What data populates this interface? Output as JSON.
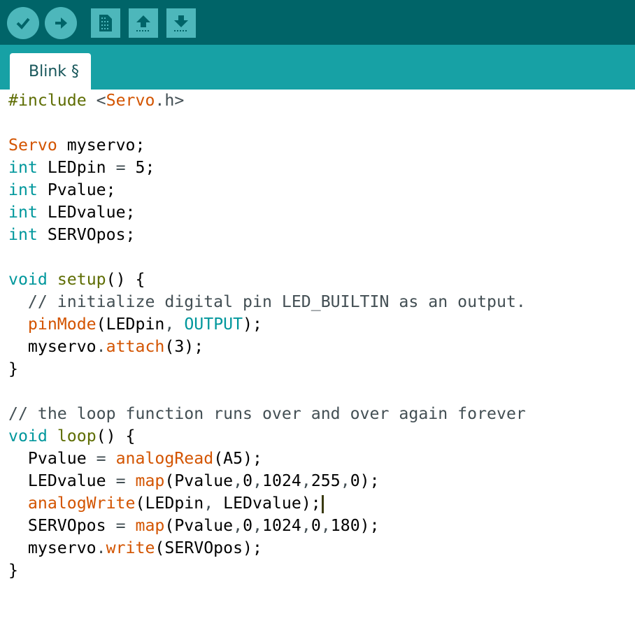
{
  "toolbar": {
    "buttons": [
      {
        "name": "verify-button",
        "icon": "check-icon"
      },
      {
        "name": "upload-button",
        "icon": "arrow-right-icon"
      },
      {
        "name": "new-button",
        "icon": "document-icon"
      },
      {
        "name": "open-button",
        "icon": "arrow-up-icon"
      },
      {
        "name": "save-button",
        "icon": "arrow-down-icon"
      }
    ]
  },
  "tab": {
    "label": "Blink §"
  },
  "colors": {
    "keyword": "#00979C",
    "function": "#D35400",
    "preprocessor": "#5E6D03",
    "toolbar": "#006468",
    "tabbar": "#17A1A5"
  },
  "code": [
    [
      [
        "#include ",
        "pp"
      ],
      [
        "<",
        "op"
      ],
      [
        "Servo",
        "fn"
      ],
      [
        ".h>",
        "op"
      ]
    ],
    [],
    [
      [
        "Servo",
        "fn"
      ],
      [
        " myservo;",
        ""
      ]
    ],
    [
      [
        "int",
        "kw"
      ],
      [
        " LEDpin ",
        ""
      ],
      [
        "=",
        "op"
      ],
      [
        " 5;",
        ""
      ]
    ],
    [
      [
        "int",
        "kw"
      ],
      [
        " Pvalue;",
        ""
      ]
    ],
    [
      [
        "int",
        "kw"
      ],
      [
        " LEDvalue;",
        ""
      ]
    ],
    [
      [
        "int",
        "kw"
      ],
      [
        " SERVOpos;",
        ""
      ]
    ],
    [],
    [
      [
        "void",
        "kw"
      ],
      [
        " ",
        ""
      ],
      [
        "setup",
        "pp"
      ],
      [
        "() {",
        ""
      ]
    ],
    [
      [
        "  // initialize digital pin LED_BUILTIN as an output.",
        "cm"
      ]
    ],
    [
      [
        "  ",
        ""
      ],
      [
        "pinMode",
        "fn"
      ],
      [
        "(LEDpin",
        ""
      ],
      [
        ", ",
        "op"
      ],
      [
        "OUTPUT",
        "kw"
      ],
      [
        ");",
        ""
      ]
    ],
    [
      [
        "  myservo",
        ""
      ],
      [
        ".",
        "op"
      ],
      [
        "attach",
        "fn"
      ],
      [
        "(3);",
        ""
      ]
    ],
    [
      [
        "}",
        ""
      ]
    ],
    [],
    [
      [
        "// the loop function runs over and over again forever",
        "cm"
      ]
    ],
    [
      [
        "void",
        "kw"
      ],
      [
        " ",
        ""
      ],
      [
        "loop",
        "pp"
      ],
      [
        "() {",
        ""
      ]
    ],
    [
      [
        "  Pvalue ",
        ""
      ],
      [
        "=",
        "op"
      ],
      [
        " ",
        ""
      ],
      [
        "analogRead",
        "fn"
      ],
      [
        "(A5);",
        ""
      ]
    ],
    [
      [
        "  LEDvalue ",
        ""
      ],
      [
        "=",
        "op"
      ],
      [
        " ",
        ""
      ],
      [
        "map",
        "fn"
      ],
      [
        "(Pvalue",
        ""
      ],
      [
        ",",
        "op"
      ],
      [
        "0",
        ""
      ],
      [
        ",",
        "op"
      ],
      [
        "1024",
        ""
      ],
      [
        ",",
        "op"
      ],
      [
        "255",
        ""
      ],
      [
        ",",
        "op"
      ],
      [
        "0);",
        ""
      ]
    ],
    [
      [
        "  ",
        ""
      ],
      [
        "analogWrite",
        "fn"
      ],
      [
        "(LEDpin",
        ""
      ],
      [
        ", ",
        "op"
      ],
      [
        "LEDvalue);",
        ""
      ],
      [
        "",
        "cursor"
      ]
    ],
    [
      [
        "  SERVOpos ",
        ""
      ],
      [
        "=",
        "op"
      ],
      [
        " ",
        ""
      ],
      [
        "map",
        "fn"
      ],
      [
        "(Pvalue",
        ""
      ],
      [
        ",",
        "op"
      ],
      [
        "0",
        ""
      ],
      [
        ",",
        "op"
      ],
      [
        "1024",
        ""
      ],
      [
        ",",
        "op"
      ],
      [
        "0",
        ""
      ],
      [
        ",",
        "op"
      ],
      [
        "180);",
        ""
      ]
    ],
    [
      [
        "  myservo",
        ""
      ],
      [
        ".",
        "op"
      ],
      [
        "write",
        "fn"
      ],
      [
        "(SERVOpos);",
        ""
      ]
    ],
    [
      [
        "}",
        ""
      ]
    ]
  ]
}
